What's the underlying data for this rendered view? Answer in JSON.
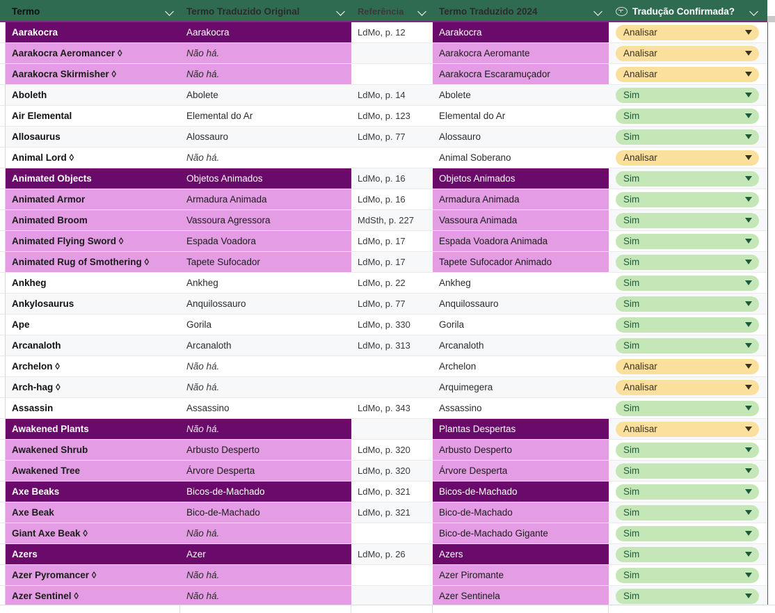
{
  "columns": [
    {
      "id": "termo",
      "label": "Termo",
      "icon": "chevron-down-icon",
      "has_filter_icon": false
    },
    {
      "id": "orig",
      "label": "Termo Traduzido Original",
      "icon": "chevron-down-icon",
      "has_filter_icon": false
    },
    {
      "id": "ref",
      "label": "Referência",
      "icon": "chevron-down-icon",
      "has_filter_icon": false
    },
    {
      "id": "t2024",
      "label": "Termo Traduzido 2024",
      "icon": "chevron-down-icon",
      "has_filter_icon": false
    },
    {
      "id": "conf",
      "label": "Tradução Confirmada?",
      "icon": "chevron-down-icon",
      "has_filter_icon": true,
      "filter_icon": "filter-icon"
    }
  ],
  "colors": {
    "header_green": "#2f6b51",
    "header_underline": "#7b2d7b",
    "group_dark_purple": "#6a0a6a",
    "group_light_purple": "#e49ce4",
    "row_white": "#ffffff",
    "row_alt": "#f7f8f9",
    "chip_sim_bg": "#c5e6b6",
    "chip_sim_text": "#1d5c3a",
    "chip_analisar_bg": "#fbdf9d",
    "chip_analisar_text": "#3a3320"
  },
  "chip_labels": {
    "sim": "Sim",
    "analisar": "Analisar"
  },
  "no_entry_text": "Não há.",
  "rows": [
    {
      "termo": "Aarakocra",
      "orig": "Aarakocra",
      "orig_italic": false,
      "ref": "LdMo, p. 12",
      "t2024": "Aarakocra",
      "conf": "Analisar",
      "tint": "dark",
      "ref_tint": "white"
    },
    {
      "termo": "Aarakocra Aeromancer ◊",
      "orig": "Não há.",
      "orig_italic": true,
      "ref": "",
      "t2024": "Aarakocra Aeromante",
      "conf": "Analisar",
      "tint": "light",
      "ref_tint": "alt"
    },
    {
      "termo": "Aarakocra Skirmisher ◊",
      "orig": "Não há.",
      "orig_italic": true,
      "ref": "",
      "t2024": "Aarakocra Escaramuçador",
      "conf": "Analisar",
      "tint": "light",
      "ref_tint": "white"
    },
    {
      "termo": "Aboleth",
      "orig": "Abolete",
      "orig_italic": false,
      "ref": "LdMo, p. 14",
      "t2024": "Abolete",
      "conf": "Sim",
      "tint": "alt",
      "ref_tint": "alt"
    },
    {
      "termo": "Air Elemental",
      "orig": "Elemental do Ar",
      "orig_italic": false,
      "ref": "LdMo, p. 123",
      "t2024": "Elemental do Ar",
      "conf": "Sim",
      "tint": "white",
      "ref_tint": "white"
    },
    {
      "termo": "Allosaurus",
      "orig": "Alossauro",
      "orig_italic": false,
      "ref": "LdMo, p. 77",
      "t2024": "Alossauro",
      "conf": "Sim",
      "tint": "alt",
      "ref_tint": "alt"
    },
    {
      "termo": "Animal Lord ◊",
      "orig": "Não há.",
      "orig_italic": true,
      "ref": "",
      "t2024": "Animal Soberano",
      "conf": "Analisar",
      "tint": "white",
      "ref_tint": "white"
    },
    {
      "termo": "Animated Objects",
      "orig": "Objetos Animados",
      "orig_italic": false,
      "ref": "LdMo, p. 16",
      "t2024": "Objetos Animados",
      "conf": "Sim",
      "tint": "dark",
      "ref_tint": "alt"
    },
    {
      "termo": "Animated Armor",
      "orig": "Armadura Animada",
      "orig_italic": false,
      "ref": "LdMo, p. 16",
      "t2024": "Armadura Animada",
      "conf": "Sim",
      "tint": "light",
      "ref_tint": "white"
    },
    {
      "termo": "Animated Broom",
      "orig": "Vassoura Agressora",
      "orig_italic": false,
      "ref": "MdSth, p. 227",
      "t2024": "Vassoura Animada",
      "conf": "Sim",
      "tint": "light",
      "ref_tint": "alt"
    },
    {
      "termo": "Animated Flying Sword ◊",
      "orig": "Espada Voadora",
      "orig_italic": false,
      "ref": "LdMo, p. 17",
      "t2024": "Espada Voadora Animada",
      "conf": "Sim",
      "tint": "light",
      "ref_tint": "white"
    },
    {
      "termo": "Animated Rug of Smothering ◊",
      "orig": "Tapete Sufocador",
      "orig_italic": false,
      "ref": "LdMo, p. 17",
      "t2024": "Tapete Sufocador Animado",
      "conf": "Sim",
      "tint": "light",
      "ref_tint": "alt"
    },
    {
      "termo": "Ankheg",
      "orig": "Ankheg",
      "orig_italic": false,
      "ref": "LdMo, p. 22",
      "t2024": "Ankheg",
      "conf": "Sim",
      "tint": "white",
      "ref_tint": "white"
    },
    {
      "termo": "Ankylosaurus",
      "orig": "Anquilossauro",
      "orig_italic": false,
      "ref": "LdMo, p. 77",
      "t2024": "Anquilossauro",
      "conf": "Sim",
      "tint": "alt",
      "ref_tint": "alt"
    },
    {
      "termo": "Ape",
      "orig": "Gorila",
      "orig_italic": false,
      "ref": "LdMo, p. 330",
      "t2024": "Gorila",
      "conf": "Sim",
      "tint": "white",
      "ref_tint": "white"
    },
    {
      "termo": "Arcanaloth",
      "orig": "Arcanaloth",
      "orig_italic": false,
      "ref": "LdMo, p. 313",
      "t2024": "Arcanaloth",
      "conf": "Sim",
      "tint": "alt",
      "ref_tint": "alt"
    },
    {
      "termo": "Archelon ◊",
      "orig": "Não há.",
      "orig_italic": true,
      "ref": "",
      "t2024": "Archelon",
      "conf": "Analisar",
      "tint": "white",
      "ref_tint": "white"
    },
    {
      "termo": "Arch-hag ◊",
      "orig": "Não há.",
      "orig_italic": true,
      "ref": "",
      "t2024": "Arquimegera",
      "conf": "Analisar",
      "tint": "alt",
      "ref_tint": "alt"
    },
    {
      "termo": "Assassin",
      "orig": "Assassino",
      "orig_italic": false,
      "ref": "LdMo, p. 343",
      "t2024": "Assassino",
      "conf": "Sim",
      "tint": "white",
      "ref_tint": "white"
    },
    {
      "termo": "Awakened Plants",
      "orig": "Não há.",
      "orig_italic": true,
      "ref": "",
      "t2024": "Plantas Despertas",
      "conf": "Analisar",
      "tint": "dark",
      "ref_tint": "alt"
    },
    {
      "termo": "Awakened Shrub",
      "orig": "Arbusto Desperto",
      "orig_italic": false,
      "ref": "LdMo, p. 320",
      "t2024": "Arbusto Desperto",
      "conf": "Sim",
      "tint": "light",
      "ref_tint": "white"
    },
    {
      "termo": "Awakened Tree",
      "orig": "Árvore Desperta",
      "orig_italic": false,
      "ref": "LdMo, p. 320",
      "t2024": "Árvore Desperta",
      "conf": "Sim",
      "tint": "light",
      "ref_tint": "alt"
    },
    {
      "termo": "Axe Beaks",
      "orig": "Bicos-de-Machado",
      "orig_italic": false,
      "ref": "LdMo, p. 321",
      "t2024": "Bicos-de-Machado",
      "conf": "Sim",
      "tint": "dark",
      "ref_tint": "white"
    },
    {
      "termo": "Axe Beak",
      "orig": "Bico-de-Machado",
      "orig_italic": false,
      "ref": "LdMo, p. 321",
      "t2024": "Bico-de-Machado",
      "conf": "Sim",
      "tint": "light",
      "ref_tint": "alt"
    },
    {
      "termo": "Giant Axe Beak ◊",
      "orig": "Não há.",
      "orig_italic": true,
      "ref": "",
      "t2024": "Bico-de-Machado Gigante",
      "conf": "Sim",
      "tint": "light",
      "ref_tint": "white"
    },
    {
      "termo": "Azers",
      "orig": "Azer",
      "orig_italic": false,
      "ref": "LdMo, p. 26",
      "t2024": "Azers",
      "conf": "Sim",
      "tint": "dark",
      "ref_tint": "alt"
    },
    {
      "termo": "Azer Pyromancer ◊",
      "orig": "Não há.",
      "orig_italic": true,
      "ref": "",
      "t2024": "Azer Piromante",
      "conf": "Sim",
      "tint": "light",
      "ref_tint": "white"
    },
    {
      "termo": "Azer Sentinel ◊",
      "orig": "Não há.",
      "orig_italic": true,
      "ref": "",
      "t2024": "Azer Sentinela",
      "conf": "Sim",
      "tint": "light",
      "ref_tint": "alt"
    }
  ]
}
